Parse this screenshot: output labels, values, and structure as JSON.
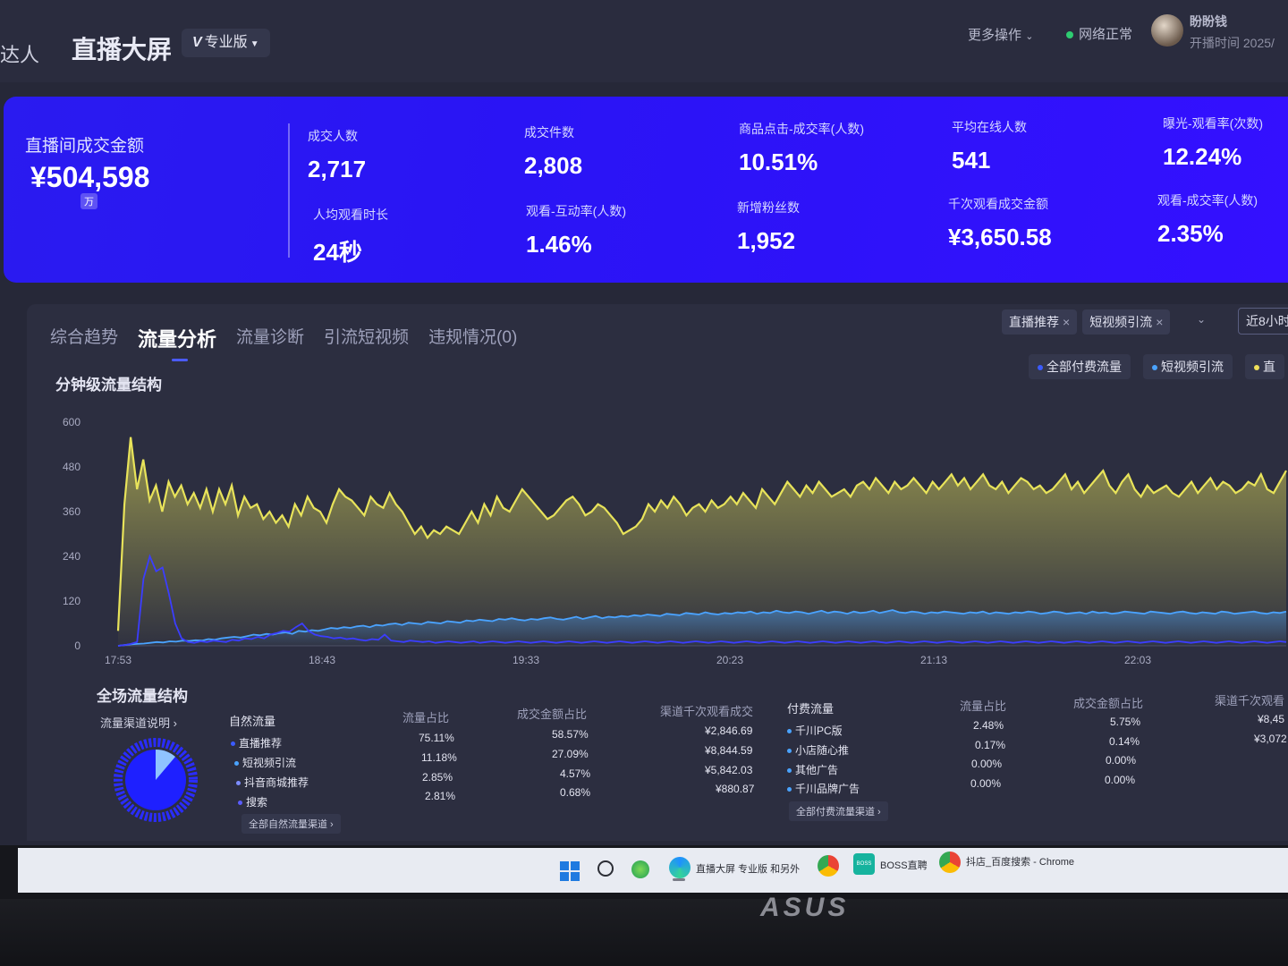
{
  "header": {
    "left_fragment": "达人",
    "title": "直播大屏",
    "badge": "专业版",
    "badge_prefix": "V",
    "more": "更多操作",
    "network": "网络正常",
    "user": "盼盼钱",
    "live_time": "开播时间 2025/"
  },
  "summary": {
    "main": {
      "label": "直播间成交金额",
      "value": "¥504,598",
      "unit": "万"
    },
    "metrics": [
      {
        "label": "成交人数",
        "value": "2,717"
      },
      {
        "label": "成交件数",
        "value": "2,808"
      },
      {
        "label": "商品点击-成交率(人数)",
        "value": "10.51%"
      },
      {
        "label": "平均在线人数",
        "value": "541"
      },
      {
        "label": "曝光-观看率(次数)",
        "value": "12.24%"
      },
      {
        "label": "人均观看时长",
        "value": "24秒"
      },
      {
        "label": "观看-互动率(人数)",
        "value": "1.46%"
      },
      {
        "label": "新增粉丝数",
        "value": "1,952"
      },
      {
        "label": "千次观看成交金额",
        "value": "¥3,650.58"
      },
      {
        "label": "观看-成交率(人数)",
        "value": "2.35%"
      }
    ]
  },
  "tabs": [
    {
      "label": "综合趋势"
    },
    {
      "label": "流量分析",
      "active": true
    },
    {
      "label": "流量诊断"
    },
    {
      "label": "引流短视频"
    },
    {
      "label": "违规情况(0)"
    }
  ],
  "filters": {
    "chips": [
      "直播推荐",
      "短视频引流"
    ],
    "chip_close": "×",
    "dropdown": "⌄",
    "range": "近8小时"
  },
  "minute_section": {
    "title": "分钟级流量结构",
    "legend": [
      {
        "label": "全部付费流量",
        "color": "#3b5bff"
      },
      {
        "label": "短视频引流",
        "color": "#4aa3ff"
      },
      {
        "label": "直",
        "color": "#f0e05a"
      }
    ]
  },
  "chart_data": {
    "type": "area",
    "x_ticks": [
      "17:53",
      "18:43",
      "19:33",
      "20:23",
      "21:13",
      "22:03"
    ],
    "y_ticks": [
      0,
      120,
      240,
      360,
      480,
      600
    ],
    "ylim": [
      0,
      600
    ],
    "series": [
      {
        "name": "直",
        "color": "#e8e35a",
        "values": [
          40,
          380,
          560,
          420,
          500,
          390,
          430,
          360,
          440,
          400,
          430,
          380,
          410,
          370,
          420,
          360,
          420,
          380,
          430,
          350,
          400,
          370,
          380,
          340,
          360,
          330,
          350,
          320,
          380,
          350,
          400,
          370,
          360,
          330,
          380,
          420,
          400,
          390,
          370,
          350,
          400,
          380,
          370,
          410,
          380,
          360,
          330,
          300,
          320,
          290,
          310,
          300,
          320,
          310,
          300,
          330,
          360,
          330,
          380,
          350,
          400,
          370,
          360,
          390,
          420,
          400,
          380,
          360,
          340,
          350,
          370,
          390,
          400,
          380,
          350,
          360,
          380,
          370,
          350,
          330,
          300,
          310,
          320,
          340,
          380,
          360,
          390,
          370,
          400,
          380,
          350,
          370,
          380,
          360,
          390,
          370,
          380,
          400,
          380,
          410,
          390,
          370,
          420,
          400,
          380,
          410,
          440,
          420,
          400,
          430,
          410,
          440,
          420,
          400,
          410,
          420,
          400,
          430,
          440,
          420,
          450,
          430,
          410,
          440,
          420,
          430,
          450,
          430,
          410,
          440,
          420,
          440,
          460,
          430,
          450,
          420,
          440,
          460,
          430,
          420,
          440,
          410,
          430,
          450,
          440,
          420,
          430,
          410,
          420,
          440,
          460,
          420,
          440,
          410,
          430,
          450,
          470,
          430,
          410,
          440,
          460,
          420,
          400,
          430,
          410,
          420,
          430,
          410,
          400,
          420,
          440,
          410,
          430,
          450,
          420,
          440,
          430,
          410,
          420,
          440,
          430,
          460,
          420,
          410,
          440,
          470
        ]
      },
      {
        "name": "短视频引流",
        "color": "#4aa3ff",
        "values": [
          0,
          2,
          4,
          5,
          6,
          8,
          10,
          9,
          12,
          11,
          14,
          13,
          15,
          14,
          18,
          16,
          20,
          22,
          24,
          22,
          26,
          30,
          28,
          32,
          30,
          34,
          36,
          32,
          40,
          38,
          42,
          40,
          44,
          48,
          46,
          50,
          48,
          52,
          54,
          50,
          56,
          54,
          58,
          60,
          56,
          62,
          60,
          58,
          64,
          62,
          60,
          66,
          64,
          62,
          68,
          66,
          70,
          68,
          66,
          72,
          70,
          74,
          70,
          68,
          72,
          70,
          74,
          76,
          72,
          70,
          74,
          78,
          72,
          76,
          80,
          74,
          78,
          76,
          80,
          78,
          82,
          80,
          84,
          82,
          80,
          86,
          84,
          82,
          88,
          86,
          84,
          90,
          86,
          84,
          88,
          86,
          90,
          88,
          92,
          86,
          90,
          88,
          94,
          90,
          88,
          92,
          90,
          86,
          90,
          94,
          88,
          92,
          90,
          86,
          92,
          88,
          90,
          94,
          88,
          92,
          96,
          90,
          88,
          92,
          90,
          86,
          90,
          88,
          92,
          90,
          88,
          86,
          90,
          88,
          92,
          86,
          90,
          88,
          86,
          90,
          88,
          92,
          90,
          86,
          88,
          92,
          90,
          86,
          88,
          90,
          86,
          92,
          88,
          90,
          86,
          88,
          92,
          90,
          88,
          86,
          92,
          90,
          88,
          86,
          90,
          92,
          88,
          86,
          90,
          88,
          86,
          92,
          90,
          86,
          88,
          90,
          92,
          88,
          86,
          90,
          88,
          92
        ]
      },
      {
        "name": "全部付费流量",
        "color": "#3b3dff",
        "values": [
          0,
          2,
          5,
          10,
          180,
          240,
          200,
          210,
          140,
          60,
          20,
          10,
          8,
          12,
          10,
          14,
          12,
          10,
          16,
          14,
          20,
          18,
          24,
          20,
          30,
          34,
          40,
          38,
          50,
          60,
          40,
          30,
          26,
          24,
          20,
          22,
          18,
          20,
          16,
          14,
          18,
          16,
          30,
          14,
          12,
          10,
          14,
          12,
          10,
          12,
          8,
          10,
          12,
          10,
          8,
          10,
          12,
          8,
          10,
          12,
          10,
          8,
          10,
          12,
          10,
          8,
          10,
          12,
          10,
          8,
          10,
          12,
          10,
          8,
          10,
          12,
          10,
          8,
          10,
          12,
          10,
          8,
          10,
          12,
          10,
          8,
          10,
          12,
          10,
          8,
          10,
          12,
          10,
          8,
          10,
          12,
          10,
          8,
          10,
          12,
          10,
          8,
          10,
          12,
          10,
          8,
          10,
          12,
          10,
          8,
          10,
          12,
          10,
          8,
          10,
          12,
          10,
          8,
          10,
          12,
          10,
          8,
          10,
          12,
          10,
          8,
          10,
          12,
          10,
          8,
          10,
          12,
          10,
          8,
          10,
          12,
          10,
          8,
          10,
          12,
          10,
          8,
          10,
          12,
          10,
          8,
          10,
          12,
          10,
          8,
          10,
          12,
          10,
          8,
          10,
          12,
          10,
          8,
          10,
          12,
          10,
          8,
          10,
          12,
          10,
          8,
          10,
          12,
          10,
          8,
          10,
          12,
          10,
          8,
          10,
          12,
          10,
          8,
          10,
          12,
          10,
          8,
          10,
          12,
          10
        ]
      }
    ]
  },
  "structure": {
    "title": "全场流量结构",
    "channel_desc": "流量渠道说明",
    "natural": {
      "title": "自然流量",
      "headers": [
        "流量占比",
        "成交金额占比",
        "渠道千次观看成交"
      ],
      "rows": [
        {
          "name": "直播推荐",
          "share": "75.11%",
          "gmv_share": "58.57%",
          "per_k": "¥2,846.69"
        },
        {
          "name": "短视频引流",
          "share": "11.18%",
          "gmv_share": "27.09%",
          "per_k": "¥8,844.59"
        },
        {
          "name": "抖音商城推荐",
          "share": "2.85%",
          "gmv_share": "4.57%",
          "per_k": "¥5,842.03"
        },
        {
          "name": "搜索",
          "share": "2.81%",
          "gmv_share": "0.68%",
          "per_k": "¥880.87"
        }
      ],
      "link": "全部自然流量渠道 ›"
    },
    "paid": {
      "title": "付费流量",
      "headers": [
        "流量占比",
        "成交金额占比",
        "渠道千次观看"
      ],
      "rows": [
        {
          "name": "千川PC版",
          "share": "2.48%",
          "gmv_share": "5.75%",
          "per_k": "¥8,45"
        },
        {
          "name": "小店随心推",
          "share": "0.17%",
          "gmv_share": "0.14%",
          "per_k": "¥3,072"
        },
        {
          "name": "其他广告",
          "share": "0.00%",
          "gmv_share": "0.00%",
          "per_k": ""
        },
        {
          "name": "千川品牌广告",
          "share": "0.00%",
          "gmv_share": "0.00%",
          "per_k": ""
        }
      ],
      "link": "全部付费流量渠道 ›"
    }
  },
  "taskbar": {
    "items": [
      {
        "label": "直播大屏 专业版 和另外"
      },
      {
        "label": "BOSS直聘"
      },
      {
        "label": "抖店_百度搜索 - Chrome"
      }
    ],
    "boss_icon_text": "BOSS"
  },
  "monitor": {
    "brand": "ASUS"
  }
}
